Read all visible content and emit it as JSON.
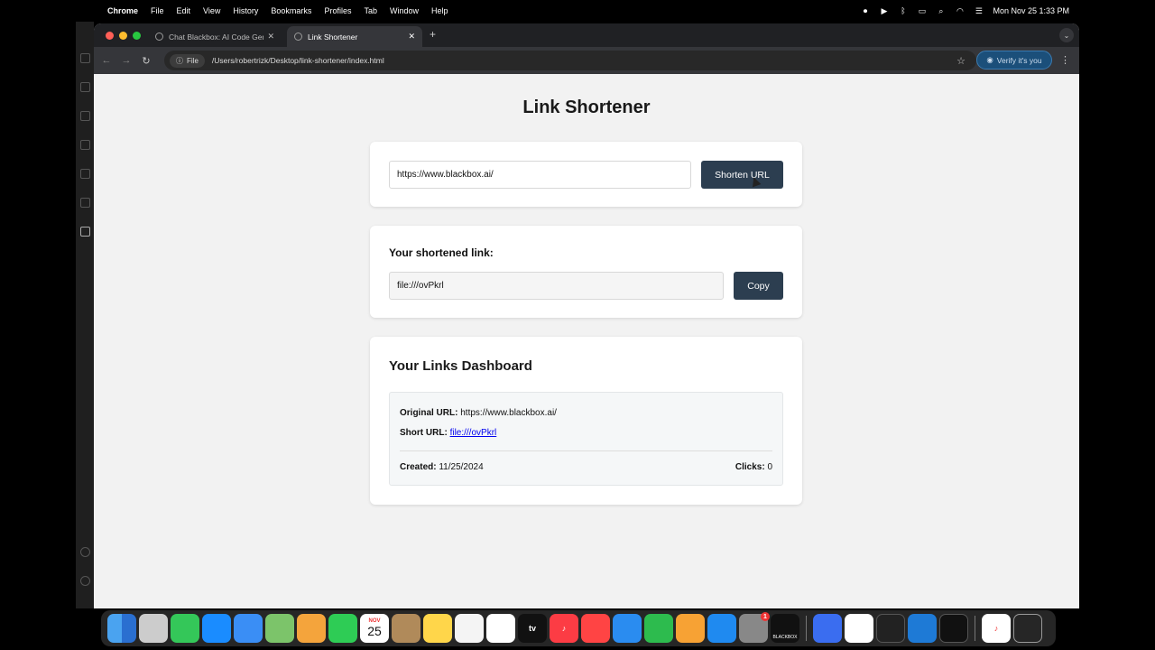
{
  "menubar": {
    "app": "Chrome",
    "items": [
      "File",
      "Edit",
      "View",
      "History",
      "Bookmarks",
      "Profiles",
      "Tab",
      "Window",
      "Help"
    ],
    "datetime": "Mon Nov 25  1:33 PM"
  },
  "browser": {
    "tabs": [
      {
        "title": "Chat Blackbox: AI Code Gene",
        "active": false
      },
      {
        "title": "Link Shortener",
        "active": true
      }
    ],
    "chip_label": "File",
    "address": "/Users/robertrizk/Desktop/link-shortener/index.html",
    "profile_button": "Verify it's you"
  },
  "page": {
    "title": "Link Shortener",
    "url_input_value": "https://www.blackbox.ai/",
    "shorten_button": "Shorten URL",
    "result_label": "Your shortened link:",
    "result_value": "file:///ovPkrl",
    "copy_button": "Copy",
    "dashboard_title": "Your Links Dashboard",
    "links": [
      {
        "original_label": "Original URL:",
        "original": "https://www.blackbox.ai/",
        "short_label": "Short URL:",
        "short": "file:///ovPkrl",
        "created_label": "Created:",
        "created": "11/25/2024",
        "clicks_label": "Clicks:",
        "clicks": "0"
      }
    ]
  },
  "dock": {
    "calendar_month": "NOV",
    "calendar_day": "25",
    "appletv_label": "tv",
    "notification_count": "1",
    "blackbox_label": "BLACKBOX"
  },
  "colors": {
    "button": "#2c3e50",
    "accent_verify": "#1b4f7a"
  }
}
